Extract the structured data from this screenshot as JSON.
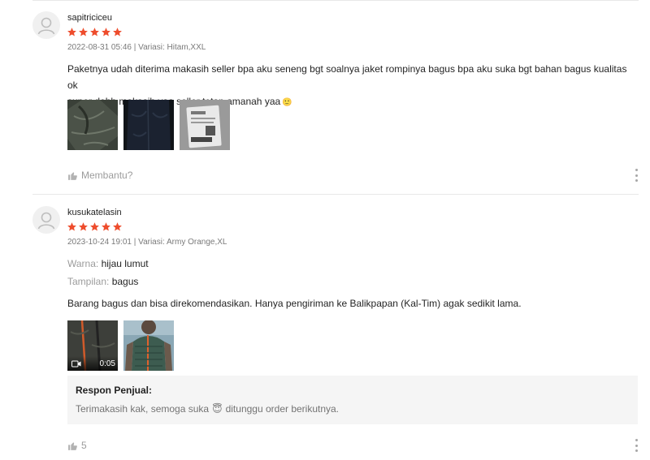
{
  "reviews": [
    {
      "username": "sapitriciceu",
      "rating": 5,
      "date": "2022-08-31 05:46",
      "variant_prefix": "Variasi:",
      "variant": "Hitam,XXL",
      "comment_line1": "Paketnya udah diterima makasih seller bpa aku seneng bgt soalnya jaket rompinya bagus bpa aku suka bgt bahan bagus kualitas ok",
      "comment_line2": "super dehh makasih yaa seller tetap amanah yaa",
      "comment_emoji": "🙂",
      "media": [
        "photo",
        "photo",
        "photo"
      ],
      "helpful_label": "Membantu?"
    },
    {
      "username": "kusukatelasin",
      "rating": 5,
      "date": "2023-10-24 19:01",
      "variant_prefix": "Variasi:",
      "variant": "Army Orange,XL",
      "attributes": [
        {
          "label": "Warna:",
          "value": "hijau lumut"
        },
        {
          "label": "Tampilan:",
          "value": "bagus"
        }
      ],
      "comment": "Barang bagus dan bisa direkomendasikan. Hanya pengiriman ke Balikpapan (Kal-Tim) agak sedikit lama.",
      "video_duration": "0:05",
      "seller_response": {
        "title": "Respon Penjual:",
        "text_before": "Terimakasih kak, semoga suka",
        "emoji": "😇",
        "text_after": "ditunggu order berikutnya."
      },
      "likes": "5"
    }
  ],
  "colors": {
    "star": "#ee4d2d",
    "divider": "#e8e8e8",
    "seller_box_bg": "#f5f5f5"
  },
  "icons": [
    "user-avatar-icon",
    "star-icon",
    "thumbs-up-icon",
    "more-vertical-icon",
    "video-camera-icon"
  ]
}
